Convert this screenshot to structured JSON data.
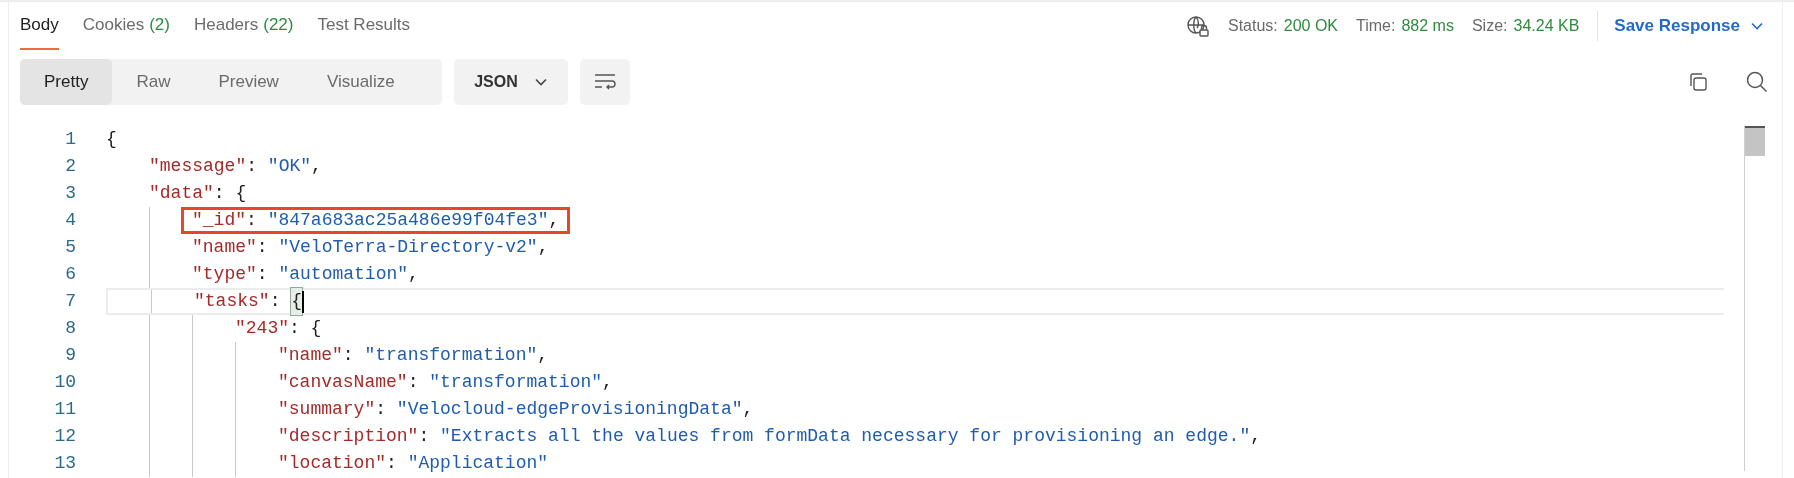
{
  "tabs": [
    {
      "label": "Body",
      "selected": true
    },
    {
      "label": "Cookies",
      "count": "(2)",
      "selected": false
    },
    {
      "label": "Headers",
      "count": "(22)",
      "selected": false
    },
    {
      "label": "Test Results",
      "selected": false
    }
  ],
  "status": [
    {
      "label": "Status:",
      "value": "200 OK"
    },
    {
      "label": "Time:",
      "value": "882 ms"
    },
    {
      "label": "Size:",
      "value": "34.24 KB"
    }
  ],
  "save_button": "Save Response",
  "view_modes": [
    {
      "label": "Pretty",
      "selected": true
    },
    {
      "label": "Raw",
      "selected": false
    },
    {
      "label": "Preview",
      "selected": false
    },
    {
      "label": "Visualize",
      "selected": false
    }
  ],
  "format_select": "JSON",
  "code_lines": [
    {
      "number": "1",
      "tokens": [
        {
          "kind": "punct",
          "text": "{"
        }
      ],
      "current": false,
      "boxed": false,
      "children": [
        {
          "number": "2",
          "tokens": [
            {
              "kind": "key",
              "text": "\"message\""
            },
            {
              "kind": "punct",
              "text": ": "
            },
            {
              "kind": "string",
              "text": "\"OK\""
            },
            {
              "kind": "punct",
              "text": ","
            }
          ],
          "current": false,
          "boxed": false
        },
        {
          "number": "3",
          "tokens": [
            {
              "kind": "key",
              "text": "\"data\""
            },
            {
              "kind": "punct",
              "text": ": {"
            }
          ],
          "current": false,
          "boxed": false,
          "children": [
            {
              "number": "4",
              "tokens": [
                {
                  "kind": "key",
                  "text": "\"_id\""
                },
                {
                  "kind": "punct",
                  "text": ": "
                },
                {
                  "kind": "string",
                  "text": "\"847a683ac25a486e99f04fe3\""
                },
                {
                  "kind": "punct",
                  "text": ","
                }
              ],
              "current": false,
              "boxed": true
            },
            {
              "number": "5",
              "tokens": [
                {
                  "kind": "key",
                  "text": "\"name\""
                },
                {
                  "kind": "punct",
                  "text": ": "
                },
                {
                  "kind": "string",
                  "text": "\"VeloTerra-Directory-v2\""
                },
                {
                  "kind": "punct",
                  "text": ","
                }
              ],
              "current": false,
              "boxed": false
            },
            {
              "number": "6",
              "tokens": [
                {
                  "kind": "key",
                  "text": "\"type\""
                },
                {
                  "kind": "punct",
                  "text": ": "
                },
                {
                  "kind": "string",
                  "text": "\"automation\""
                },
                {
                  "kind": "punct",
                  "text": ","
                }
              ],
              "current": false,
              "boxed": false
            },
            {
              "number": "7",
              "tokens": [
                {
                  "kind": "key",
                  "text": "\"tasks\""
                },
                {
                  "kind": "punct",
                  "text": ": "
                },
                {
                  "kind": "bracket",
                  "text": "{"
                }
              ],
              "current": true,
              "boxed": false,
              "children": [
                {
                  "number": "8",
                  "tokens": [
                    {
                      "kind": "key",
                      "text": "\"243\""
                    },
                    {
                      "kind": "punct",
                      "text": ": {"
                    }
                  ],
                  "current": false,
                  "boxed": false,
                  "children": [
                    {
                      "number": "9",
                      "tokens": [
                        {
                          "kind": "key",
                          "text": "\"name\""
                        },
                        {
                          "kind": "punct",
                          "text": ": "
                        },
                        {
                          "kind": "string",
                          "text": "\"transformation\""
                        },
                        {
                          "kind": "punct",
                          "text": ","
                        }
                      ],
                      "current": false,
                      "boxed": false
                    },
                    {
                      "number": "10",
                      "tokens": [
                        {
                          "kind": "key",
                          "text": "\"canvasName\""
                        },
                        {
                          "kind": "punct",
                          "text": ": "
                        },
                        {
                          "kind": "string",
                          "text": "\"transformation\""
                        },
                        {
                          "kind": "punct",
                          "text": ","
                        }
                      ],
                      "current": false,
                      "boxed": false
                    },
                    {
                      "number": "11",
                      "tokens": [
                        {
                          "kind": "key",
                          "text": "\"summary\""
                        },
                        {
                          "kind": "punct",
                          "text": ": "
                        },
                        {
                          "kind": "string",
                          "text": "\"Velocloud-edgeProvisioningData\""
                        },
                        {
                          "kind": "punct",
                          "text": ","
                        }
                      ],
                      "current": false,
                      "boxed": false
                    },
                    {
                      "number": "12",
                      "tokens": [
                        {
                          "kind": "key",
                          "text": "\"description\""
                        },
                        {
                          "kind": "punct",
                          "text": ": "
                        },
                        {
                          "kind": "string",
                          "text": "\"Extracts all the values from formData necessary for provisioning an edge.\""
                        },
                        {
                          "kind": "punct",
                          "text": ","
                        }
                      ],
                      "current": false,
                      "boxed": false
                    },
                    {
                      "number": "13",
                      "tokens": [
                        {
                          "kind": "key",
                          "text": "\"location\""
                        },
                        {
                          "kind": "punct",
                          "text": ": "
                        },
                        {
                          "kind": "string",
                          "text": "\"Application\""
                        }
                      ],
                      "current": false,
                      "boxed": false
                    }
                  ]
                }
              ]
            }
          ]
        }
      ]
    }
  ]
}
